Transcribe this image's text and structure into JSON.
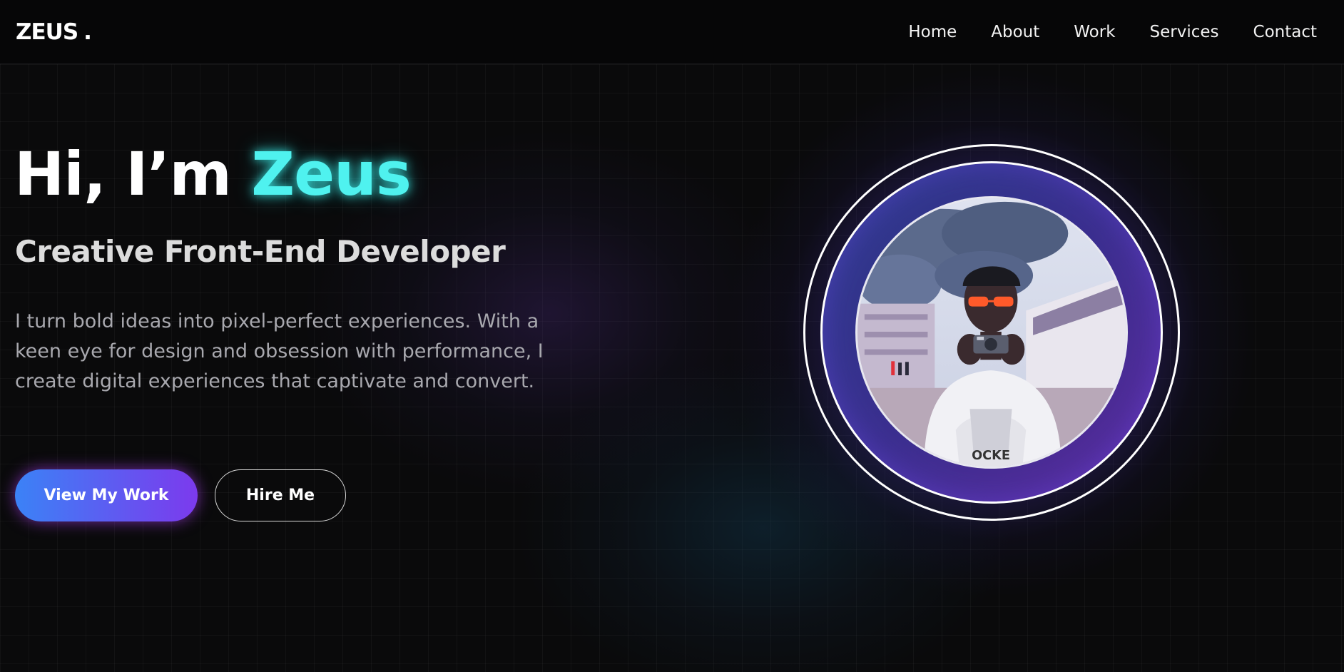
{
  "header": {
    "logo": "ZEUS",
    "logo_dot": ".",
    "nav": [
      {
        "label": "Home"
      },
      {
        "label": "About"
      },
      {
        "label": "Work"
      },
      {
        "label": "Services"
      },
      {
        "label": "Contact"
      }
    ]
  },
  "hero": {
    "greeting": "Hi, I’m ",
    "name": "Zeus",
    "subtitle": "Creative Front-End Developer",
    "description": "I turn bold ideas into pixel-perfect experiences. With a keen eye for design and obsession with performance, I create digital experiences that captivate and convert.",
    "primary_button": "View My Work",
    "secondary_button": "Hire Me"
  },
  "colors": {
    "accent": "#4ff2ef",
    "button_gradient_start": "#3b82f6",
    "button_gradient_end": "#7c3aed",
    "background": "#0a0a0b"
  }
}
